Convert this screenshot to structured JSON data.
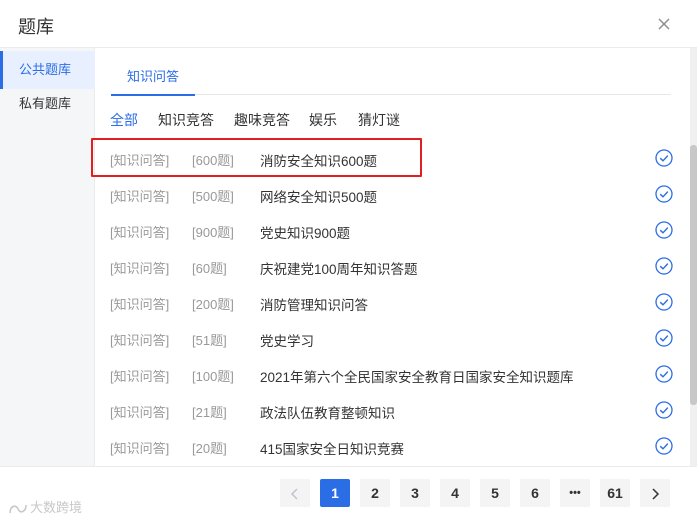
{
  "dialog": {
    "title": "题库"
  },
  "sidebar": {
    "items": [
      {
        "label": "公共题库",
        "active": true
      },
      {
        "label": "私有题库",
        "active": false
      }
    ]
  },
  "main": {
    "tab": "知识问答",
    "filters": [
      {
        "label": "全部",
        "active": true
      },
      {
        "label": "知识竞答"
      },
      {
        "label": "趣味竞答"
      },
      {
        "label": "娱乐"
      },
      {
        "label": "猜灯谜"
      }
    ],
    "banks": [
      {
        "category": "[知识问答]",
        "count": "[600题]",
        "name": "消防安全知识600题"
      },
      {
        "category": "[知识问答]",
        "count": "[500题]",
        "name": "网络安全知识500题"
      },
      {
        "category": "[知识问答]",
        "count": "[900题]",
        "name": "党史知识900题"
      },
      {
        "category": "[知识问答]",
        "count": "[60题]",
        "name": "庆祝建党100周年知识答题"
      },
      {
        "category": "[知识问答]",
        "count": "[200题]",
        "name": "消防管理知识问答"
      },
      {
        "category": "[知识问答]",
        "count": "[51题]",
        "name": "党史学习"
      },
      {
        "category": "[知识问答]",
        "count": "[100题]",
        "name": "2021年第六个全民国家安全教育日国家安全知识题库"
      },
      {
        "category": "[知识问答]",
        "count": "[21题]",
        "name": "政法队伍教育整顿知识"
      },
      {
        "category": "[知识问答]",
        "count": "[20题]",
        "name": "415国家安全日知识竞赛"
      }
    ]
  },
  "pagination": {
    "prev_icon": "chevron-left-icon",
    "pages": [
      "1",
      "2",
      "3",
      "4",
      "5",
      "6",
      "•••",
      "61"
    ],
    "current": "1",
    "next_icon": "chevron-right-icon"
  },
  "watermark": "大数跨境",
  "colors": {
    "accent": "#2b6de5",
    "highlight": "#e02020"
  }
}
